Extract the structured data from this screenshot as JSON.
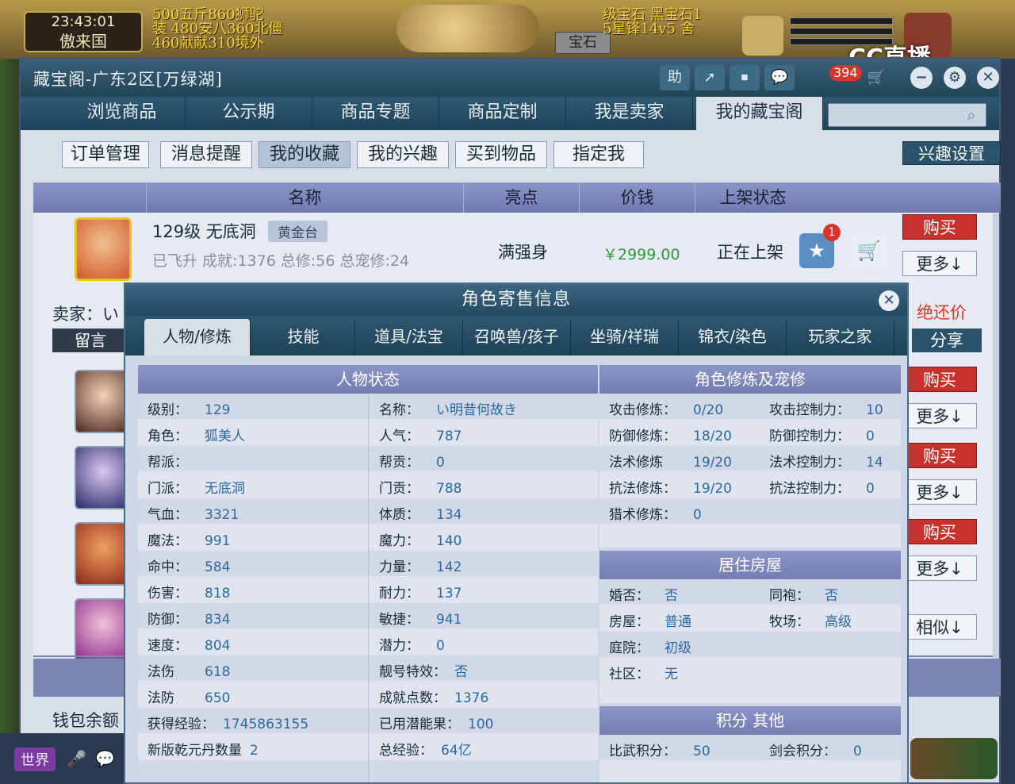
{
  "game": {
    "clock_time": "23:43:01",
    "clock_name": "傲来国",
    "feed_left": [
      "500五斤860狮驼",
      "装 480安八360北僵",
      "460献献310境外"
    ],
    "feed_center": "宝石",
    "feed_right": [
      "级宝石 黑宝石1",
      "5星锋14v5 舍"
    ],
    "watermark": "CC直播",
    "world_label": "世界"
  },
  "window": {
    "title": "藏宝阁-广东2区[万绿湖]",
    "toolbar": {
      "help": "助",
      "mail_badge": "394"
    },
    "nav_tabs": [
      "浏览商品",
      "公示期",
      "商品专题",
      "商品定制",
      "我是卖家",
      "我的藏宝阁"
    ],
    "active_nav": 5,
    "search_placeholder": ""
  },
  "subtabs": [
    "订单管理",
    "消息提醒",
    "我的收藏",
    "我的兴趣",
    "买到物品",
    "指定我"
  ],
  "active_subtab": 2,
  "interest_button": "兴趣设置",
  "table": {
    "headers": [
      "名称",
      "亮点",
      "价钱",
      "上架状态"
    ]
  },
  "listing": {
    "title": "129级 无底洞",
    "tag": "黄金台",
    "subtitle": "已飞升 成就:1376 总修:56 总宠修:24",
    "highlight": "满强身",
    "price": "￥2999.00",
    "status": "正在上架",
    "favorite_badge": "1",
    "seller_label": "卖家：い",
    "message_button": "留言",
    "reject_text": "绝还价",
    "share_button": "分享",
    "wallet_label": "钱包余额"
  },
  "row_buttons": {
    "buy": "购买",
    "more": "更多↓",
    "similar": "相似↓"
  },
  "popup": {
    "title": "角色寄售信息",
    "tabs": [
      "人物/修炼",
      "技能",
      "道具/法宝",
      "召唤兽/孩子",
      "坐骑/祥瑞",
      "锦衣/染色",
      "玩家之家"
    ],
    "active_tab": 0,
    "status_title": "人物状态",
    "cultivation_title": "角色修炼及宠修",
    "house_title": "居住房屋",
    "points_title": "积分 其他",
    "status_left": [
      {
        "k": "级别：",
        "v": "129"
      },
      {
        "k": "角色：",
        "v": "狐美人"
      },
      {
        "k": "帮派：",
        "v": ""
      },
      {
        "k": "门派：",
        "v": "无底洞"
      },
      {
        "k": "气血：",
        "v": "3321"
      },
      {
        "k": "魔法：",
        "v": "991"
      },
      {
        "k": "命中：",
        "v": "584"
      },
      {
        "k": "伤害：",
        "v": "818"
      },
      {
        "k": "防御：",
        "v": "834"
      },
      {
        "k": "速度：",
        "v": "804"
      },
      {
        "k": "法伤",
        "v": "618"
      },
      {
        "k": "法防",
        "v": "650"
      },
      {
        "k": "获得经验：",
        "v": "1745863155"
      },
      {
        "k": "新版乾元丹数量",
        "v": "2"
      }
    ],
    "status_right": [
      {
        "k": "名称：",
        "v": "い明昔何故き"
      },
      {
        "k": "人气：",
        "v": "787"
      },
      {
        "k": "帮贡：",
        "v": "0"
      },
      {
        "k": "门贡：",
        "v": "788"
      },
      {
        "k": "体质：",
        "v": "134"
      },
      {
        "k": "魔力：",
        "v": "140"
      },
      {
        "k": "力量：",
        "v": "142"
      },
      {
        "k": "耐力：",
        "v": "137"
      },
      {
        "k": "敏捷：",
        "v": "941"
      },
      {
        "k": "潜力：",
        "v": "0"
      },
      {
        "k": "靓号特效：",
        "v": "否"
      },
      {
        "k": "成就点数：",
        "v": "1376"
      },
      {
        "k": "已用潜能果：",
        "v": "100"
      },
      {
        "k": "总经验：",
        "v": "64亿"
      }
    ],
    "cult_left": [
      {
        "k": "攻击修炼：",
        "v": "0/20"
      },
      {
        "k": "防御修炼：",
        "v": "18/20"
      },
      {
        "k": "法术修炼",
        "v": "19/20"
      },
      {
        "k": "抗法修炼：",
        "v": "19/20"
      },
      {
        "k": "猎术修炼：",
        "v": "0"
      }
    ],
    "cult_right": [
      {
        "k": "攻击控制力：",
        "v": "10"
      },
      {
        "k": "防御控制力：",
        "v": "0"
      },
      {
        "k": "法术控制力：",
        "v": "14"
      },
      {
        "k": "抗法控制力：",
        "v": "0"
      }
    ],
    "house_left": [
      {
        "k": "婚否：",
        "v": "否"
      },
      {
        "k": "房屋：",
        "v": "普通"
      },
      {
        "k": "庭院：",
        "v": "初级"
      },
      {
        "k": "社区：",
        "v": "无"
      }
    ],
    "house_right": [
      {
        "k": "同袍：",
        "v": "否"
      },
      {
        "k": "牧场：",
        "v": "高级"
      }
    ],
    "points_left": [
      {
        "k": "比武积分：",
        "v": "50"
      }
    ],
    "points_right": [
      {
        "k": "剑会积分：",
        "v": "0"
      }
    ]
  },
  "colors": {
    "accent": "#2a5268",
    "buy": "#c7332c",
    "value": "#2a6aa0"
  }
}
